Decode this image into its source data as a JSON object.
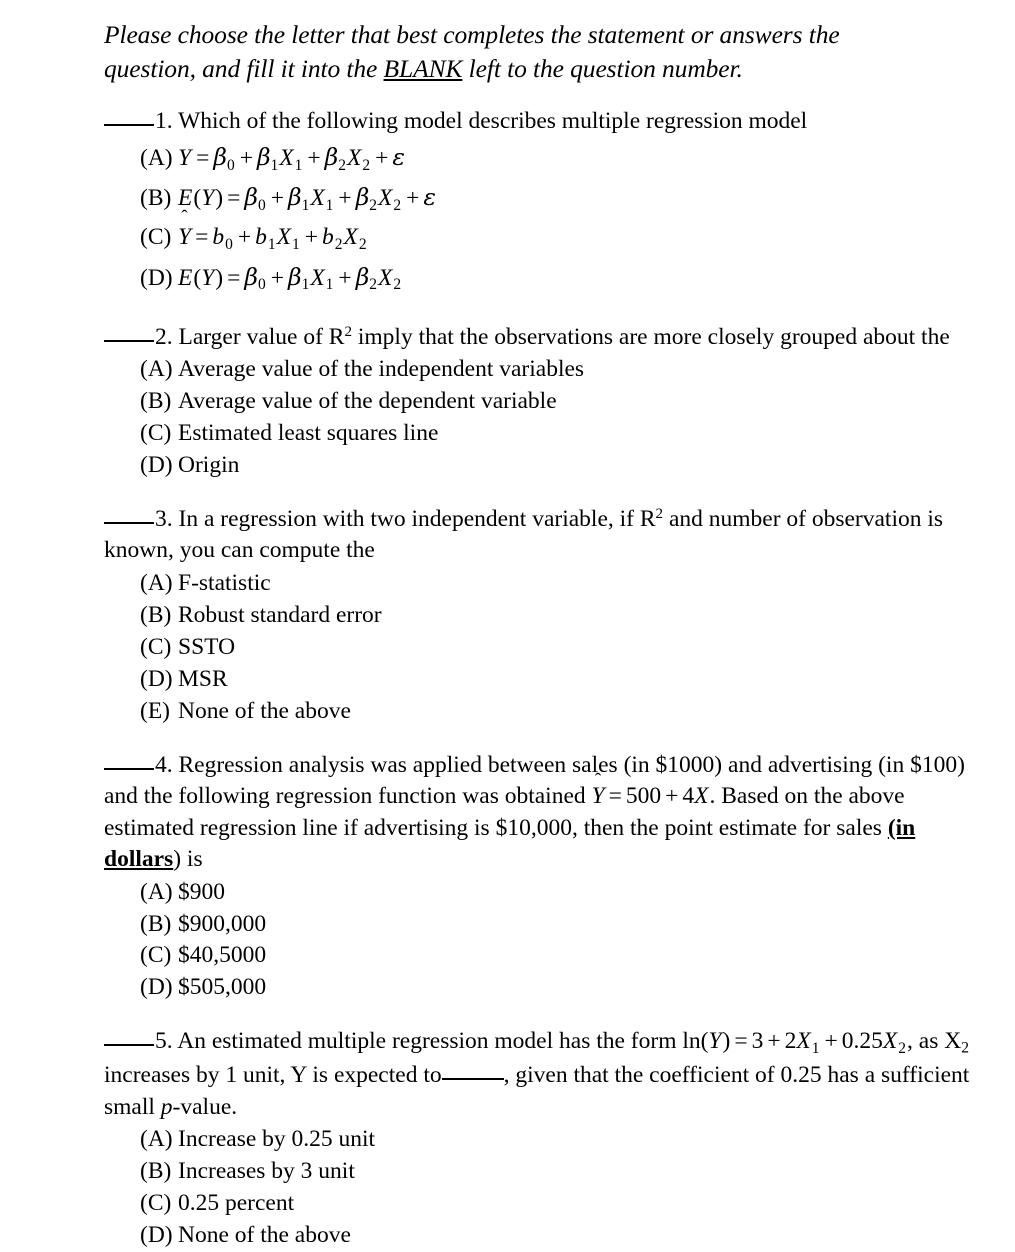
{
  "document": {
    "instructions": {
      "text_before": "Please choose the letter that best completes the statement or answers the question, and fill it into the ",
      "underlined_word": "BLANK",
      "text_after": " left to the question number."
    },
    "questions": [
      {
        "number": "1.",
        "stem": "Which of the following model describes multiple regression model",
        "options": [
          {
            "label": "(A)",
            "text": "Y = β0 + β1X1 + β2X2 + ε",
            "type": "math",
            "id": "q1a"
          },
          {
            "label": "(B)",
            "text": "E(Y) = β0 + β1X1 + β2X2 + ε",
            "type": "math",
            "id": "q1b"
          },
          {
            "label": "(C)",
            "text": "Ŷ = b0 + b1X1 + b2X2",
            "type": "math",
            "id": "q1c"
          },
          {
            "label": "(D)",
            "text": "E(Y) = β0 + β1X1 + β2X2",
            "type": "math",
            "id": "q1d"
          }
        ]
      },
      {
        "number": "2.",
        "stem_part1": "Larger value of R",
        "stem_exponent": "2",
        "stem_part2": " imply that the observations are more closely grouped about the",
        "options": [
          {
            "label": "(A)",
            "text": "Average value of the independent variables"
          },
          {
            "label": "(B)",
            "text": "Average value of the dependent variable"
          },
          {
            "label": "(C)",
            "text": "Estimated least squares line"
          },
          {
            "label": "(D)",
            "text": "Origin"
          }
        ]
      },
      {
        "number": "3.",
        "stem_part1": "In a regression with two independent variable, if R",
        "stem_exponent": "2",
        "stem_part2": " and number of observation is known, you can compute the",
        "options": [
          {
            "label": "(A)",
            "text": "F-statistic"
          },
          {
            "label": "(B)",
            "text": "Robust standard error"
          },
          {
            "label": "(C)",
            "text": "SSTO"
          },
          {
            "label": "(D)",
            "text": "MSR"
          },
          {
            "label": "(E)",
            "text": "None of the above"
          }
        ]
      },
      {
        "number": "4.",
        "stem_part1": "Regression analysis was applied between sales (in $1000) and advertising (in $100) and the following regression function was obtained ",
        "formula": "Ŷ = 500 + 4X",
        "stem_part2": ".  Based on the above estimated regression line if advertising is $10,000, then the point estimate for sales ",
        "emphasis": "(in dollars",
        "stem_part3": ") is",
        "options": [
          {
            "label": "(A)",
            "text": "$900"
          },
          {
            "label": "(B)",
            "text": "$900,000"
          },
          {
            "label": "(C)",
            "text": "$40,5000"
          },
          {
            "label": "(D)",
            "text": "$505,000"
          }
        ]
      },
      {
        "number": "5.",
        "stem_part1": "An estimated multiple regression model has the form ",
        "formula": "ln(Y) = 3 + 2X1 + 0.25X2",
        "stem_part2": ", as X",
        "sub1": "2",
        "stem_part3": " increases by 1 unit, Y is expected to",
        "stem_part4": ", given that the coefficient of 0.25 has a sufficient small ",
        "italic_p": "p",
        "stem_part5": "-value.",
        "options": [
          {
            "label": "(A)",
            "text": "Increase by 0.25 unit"
          },
          {
            "label": "(B)",
            "text": "Increases by 3 unit"
          },
          {
            "label": "(C)",
            "text": "0.25 percent"
          },
          {
            "label": "(D)",
            "text": "None of the above"
          }
        ]
      }
    ]
  }
}
